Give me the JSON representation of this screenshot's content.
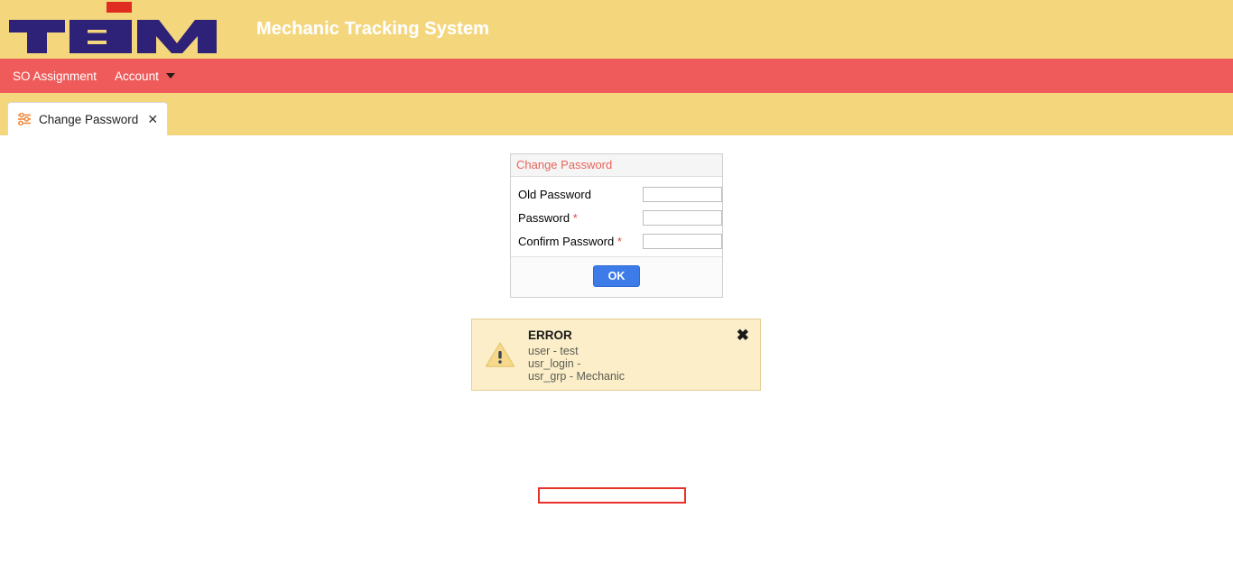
{
  "header": {
    "logo_text": "TEİM",
    "logo_name": "teim-logo",
    "app_title": "Mechanic Tracking System",
    "colors": {
      "header_bg": "#f4d67c",
      "nav_bg": "#ef5b5b",
      "logo_navy": "#2e2178",
      "logo_red": "#e02b20",
      "accent_blue": "#3d7ce8",
      "error_red": "#e8312a"
    }
  },
  "nav": {
    "items": [
      {
        "label": "SO Assignment",
        "has_caret": false
      },
      {
        "label": "Account",
        "has_caret": true
      }
    ]
  },
  "tabs": [
    {
      "label": "Change Password",
      "icon": "sliders-icon",
      "close_label": "✕",
      "active": true
    }
  ],
  "form": {
    "title": "Change Password",
    "fields": [
      {
        "label": "Old Password",
        "required": false,
        "value": "",
        "placeholder": ""
      },
      {
        "label": "Password",
        "required": true,
        "value": "",
        "placeholder": ""
      },
      {
        "label": "Confirm Password",
        "required": true,
        "value": "",
        "placeholder": ""
      }
    ],
    "required_marker": "*",
    "submit_label": "OK"
  },
  "error_panel": {
    "icon": "warning-triangle-icon",
    "title": "ERROR",
    "close_label": "✖",
    "lines": [
      "user - test",
      "usr_login -",
      "usr_grp - Mechanic"
    ],
    "highlighted_line_index": 1
  }
}
